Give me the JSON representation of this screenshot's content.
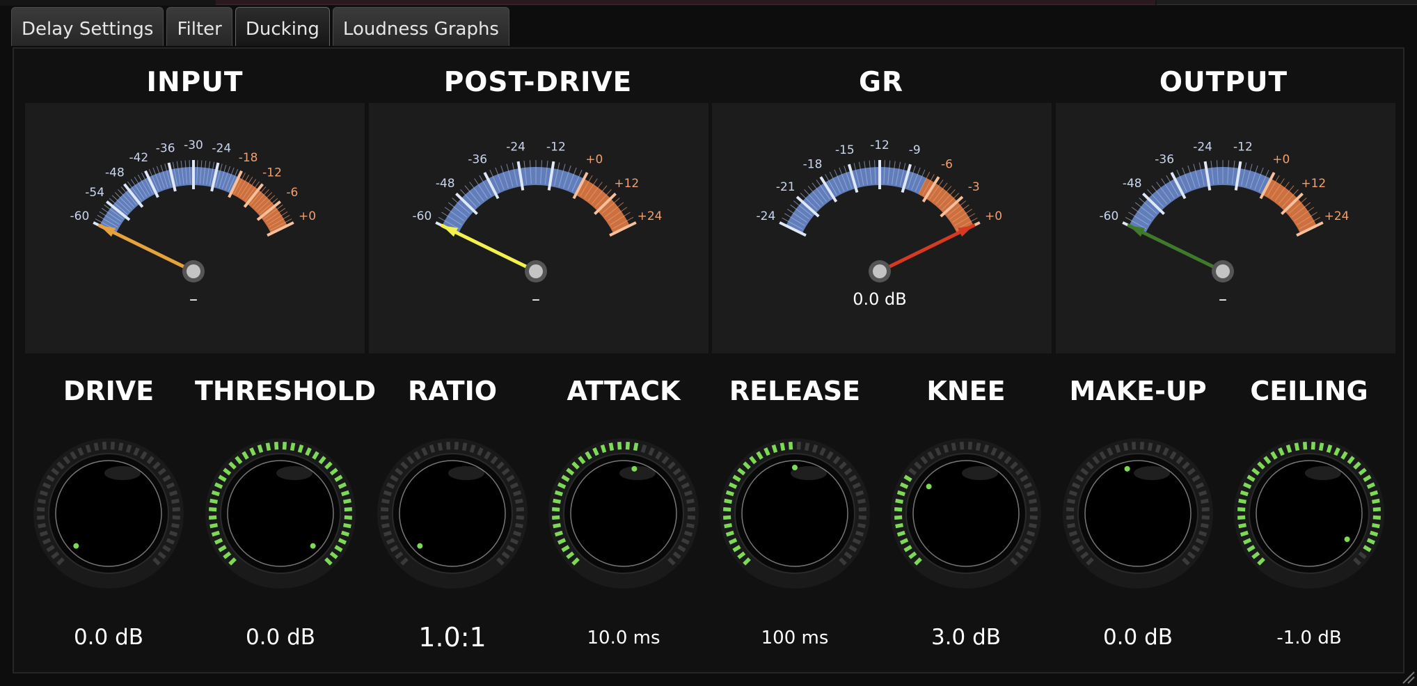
{
  "tabs": [
    {
      "label": "Delay Settings",
      "active": false
    },
    {
      "label": "Filter",
      "active": false
    },
    {
      "label": "Ducking",
      "active": true
    },
    {
      "label": "Loudness Graphs",
      "active": false
    }
  ],
  "meters": [
    {
      "title": "INPUT",
      "readout": "–",
      "needle_color": "#e6a23c",
      "needle_value": -60,
      "scale_min": -60,
      "scale_max": 0,
      "orange_from": -18,
      "major_ticks": [
        -60,
        -54,
        -48,
        -42,
        -36,
        -30,
        -24,
        -18,
        -12,
        -6,
        0
      ],
      "minor_step": 1,
      "labels": [
        "-60",
        "-54",
        "-48",
        "-42",
        "-36",
        "-30",
        "-24",
        "-18",
        "-12",
        "-6",
        "+0"
      ]
    },
    {
      "title": "POST-DRIVE",
      "readout": "–",
      "needle_color": "#f4f050",
      "needle_value": -60,
      "scale_min": -60,
      "scale_max": 24,
      "orange_from": 0,
      "major_ticks": [
        -60,
        -48,
        -36,
        -24,
        -12,
        0,
        12,
        24
      ],
      "minor_step": 2,
      "labels": [
        "-60",
        "-48",
        "-36",
        "-24",
        "-12",
        "+0",
        "+12",
        "+24"
      ]
    },
    {
      "title": "GR",
      "readout": "0.0 dB",
      "needle_color": "#d63a22",
      "needle_value": 0,
      "scale_min": -24,
      "scale_max": 0,
      "orange_from": -7,
      "major_ticks": [
        -24,
        -21,
        -18,
        -15,
        -12,
        -9,
        -6,
        -3,
        0
      ],
      "minor_step": 0.5,
      "labels": [
        "-24",
        "-21",
        "-18",
        "-15",
        "-12",
        "-9",
        "-6",
        "-3",
        "+0"
      ]
    },
    {
      "title": "OUTPUT",
      "readout": "–",
      "needle_color": "#3f7a2a",
      "needle_value": -60,
      "scale_min": -60,
      "scale_max": 24,
      "orange_from": 0,
      "major_ticks": [
        -60,
        -48,
        -36,
        -24,
        -12,
        0,
        12,
        24
      ],
      "minor_step": 2,
      "labels": [
        "-60",
        "-48",
        "-36",
        "-24",
        "-12",
        "+0",
        "+12",
        "+24"
      ]
    }
  ],
  "colors": {
    "scale_blue": "#6f8fd6",
    "scale_orange": "#e07a45",
    "label_blue": "#c9d6ee",
    "label_orange": "#f0a070",
    "knob_led_on": "#7ed957",
    "knob_led_off": "#3a3a3a"
  },
  "knobs": [
    {
      "title": "DRIVE",
      "value": "0.0 dB",
      "level": 0.0,
      "size": "normal"
    },
    {
      "title": "THRESHOLD",
      "value": "0.0 dB",
      "level": 1.0,
      "size": "normal"
    },
    {
      "title": "RATIO",
      "value": "1.0:1",
      "level": 0.0,
      "size": "big"
    },
    {
      "title": "ATTACK",
      "value": "10.0 ms",
      "level": 0.55,
      "size": "small"
    },
    {
      "title": "RELEASE",
      "value": "100 ms",
      "level": 0.5,
      "size": "small"
    },
    {
      "title": "KNEE",
      "value": "3.0 dB",
      "level": 0.3,
      "size": "normal"
    },
    {
      "title": "MAKE-UP",
      "value": "0.0 dB",
      "level": 0.45,
      "size": "normal",
      "unlit": true
    },
    {
      "title": "CEILING",
      "value": "-1.0 dB",
      "level": 0.96,
      "size": "small"
    }
  ]
}
